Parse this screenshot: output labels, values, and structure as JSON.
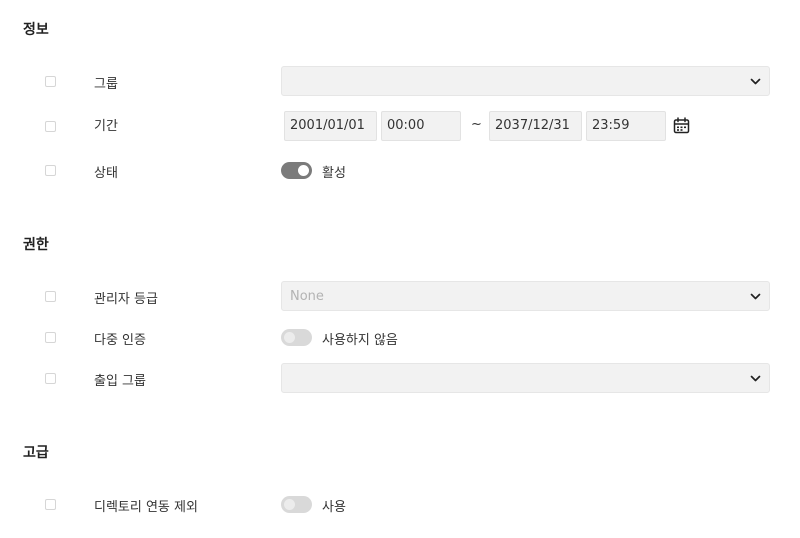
{
  "sections": {
    "info": {
      "title": "정보"
    },
    "permission": {
      "title": "권한"
    },
    "advanced": {
      "title": "고급"
    }
  },
  "info": {
    "group": {
      "label": "그룹",
      "value": ""
    },
    "period": {
      "label": "기간",
      "start_date": "2001/01/01",
      "start_time": "00:00",
      "separator": "~",
      "end_date": "2037/12/31",
      "end_time": "23:59"
    },
    "status": {
      "label": "상태",
      "toggle_label": "활성",
      "enabled": true
    }
  },
  "permission": {
    "admin_level": {
      "label": "관리자 등급",
      "value": "None"
    },
    "mfa": {
      "label": "다중 인증",
      "toggle_label": "사용하지 않음",
      "enabled": false
    },
    "access_group": {
      "label": "출입 그룹",
      "value": ""
    }
  },
  "advanced": {
    "directory_sync": {
      "label": "디렉토리 연동 제외",
      "toggle_label": "사용",
      "enabled": false
    }
  },
  "icons": [
    "chevron-down-icon",
    "calendar-icon"
  ]
}
